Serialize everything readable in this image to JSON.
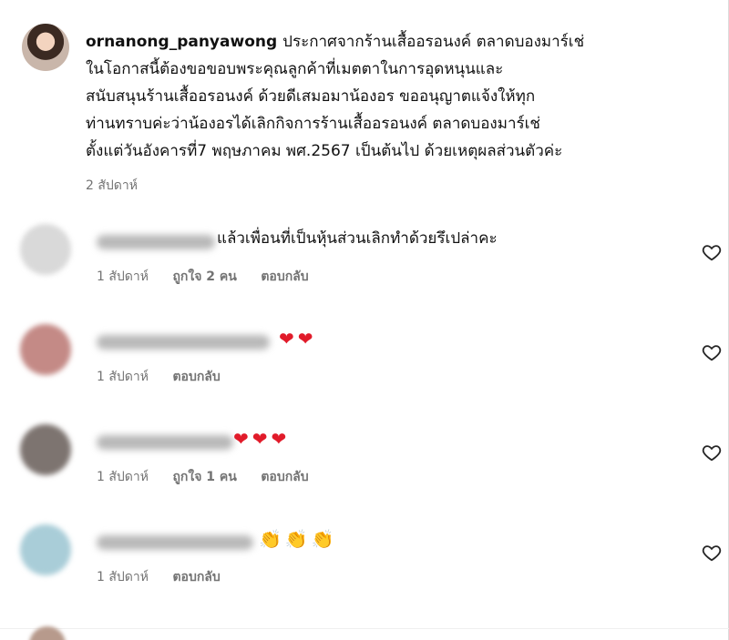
{
  "caption": {
    "username": "ornanong_panyawong",
    "lines": [
      "ประกาศจากร้านเสื้ออรอนงค์ ตลาดบองมาร์เช่",
      "ในโอกาสนี้ต้องขอขอบพระคุณลูกค้าที่เมตตาในการอุดหนุนและ",
      "สนับสนุนร้านเสื้ออรอนงค์ ด้วยดีเสมอมาน้องอร ขออนุญาตแจ้งให้ทุก",
      "ท่านทราบค่ะว่าน้องอรได้เลิกกิจการร้านเสื้ออรอนงค์ ตลาดบองมาร์เช่",
      "ตั้งแต่วันอังคารที่7 พฤษภาคม พศ.2567 เป็นต้นไป ด้วยเหตุผลส่วนตัวค่ะ"
    ],
    "time": "2 สัปดาห์"
  },
  "comments": [
    {
      "text": "แล้วเพื่อนที่เป็นหุ้นส่วนเลิกทำด้วยรึเปล่าคะ",
      "time": "1 สัปดาห์",
      "likes": "ถูกใจ 2 คน",
      "reply": "ตอบกลับ",
      "emojis": [],
      "avatar_color": "#d9d9d9"
    },
    {
      "text": "",
      "time": "1 สัปดาห์",
      "likes": "",
      "reply": "ตอบกลับ",
      "emojis": [
        "heart-emoji",
        "heart-emoji"
      ],
      "avatar_color": "#c48a86"
    },
    {
      "text": "",
      "time": "1 สัปดาห์",
      "likes": "ถูกใจ 1 คน",
      "reply": "ตอบกลับ",
      "emojis": [
        "heart-emoji",
        "heart-emoji",
        "heart-emoji"
      ],
      "avatar_color": "#7d7470"
    },
    {
      "text": "",
      "time": "1 สัปดาห์",
      "likes": "",
      "reply": "ตอบกลับ",
      "emojis": [
        "clap-emoji",
        "clap-emoji",
        "clap-emoji"
      ],
      "avatar_color": "#a9cdd8"
    }
  ],
  "icons": {
    "like": "heart-outline-icon",
    "heart_glyph": "❤",
    "clap_glyph": "👏"
  }
}
